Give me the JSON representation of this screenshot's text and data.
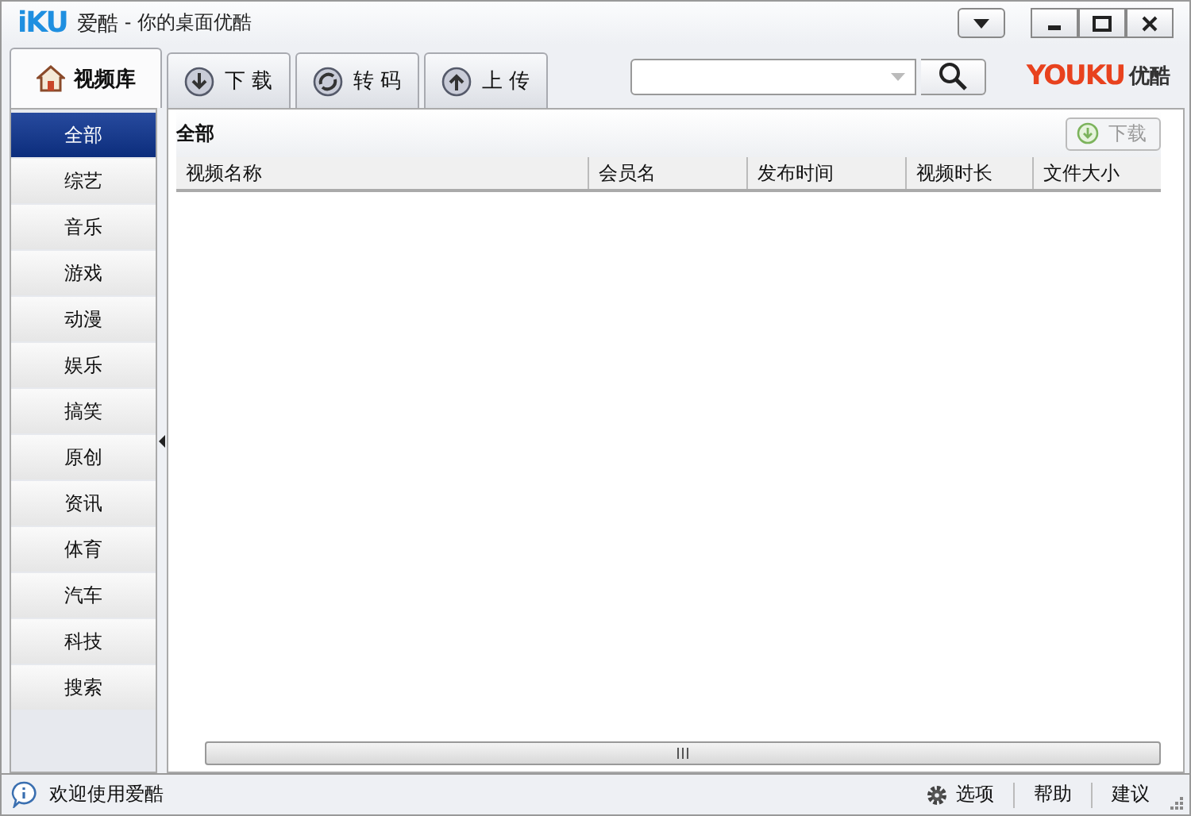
{
  "window": {
    "logo": "iKU",
    "app_name": "爱酷",
    "subtitle": "- 你的桌面优酷"
  },
  "tabs": [
    {
      "label": "视频库",
      "kind": "home",
      "selected": true
    },
    {
      "label": "下 载",
      "kind": "download",
      "selected": false
    },
    {
      "label": "转 码",
      "kind": "convert",
      "selected": false
    },
    {
      "label": "上 传",
      "kind": "upload",
      "selected": false
    }
  ],
  "brand": {
    "logo": "YOUKU",
    "name": "优酷"
  },
  "sidebar": {
    "items": [
      {
        "label": "全部",
        "selected": true
      },
      {
        "label": "综艺",
        "selected": false
      },
      {
        "label": "音乐",
        "selected": false
      },
      {
        "label": "游戏",
        "selected": false
      },
      {
        "label": "动漫",
        "selected": false
      },
      {
        "label": "娱乐",
        "selected": false
      },
      {
        "label": "搞笑",
        "selected": false
      },
      {
        "label": "原创",
        "selected": false
      },
      {
        "label": "资讯",
        "selected": false
      },
      {
        "label": "体育",
        "selected": false
      },
      {
        "label": "汽车",
        "selected": false
      },
      {
        "label": "科技",
        "selected": false
      },
      {
        "label": "搜索",
        "selected": false
      }
    ]
  },
  "panel": {
    "title": "全部",
    "download_button": {
      "label": "下载",
      "disabled": true
    }
  },
  "table": {
    "columns": [
      "视频名称",
      "会员名",
      "发布时间",
      "视频时长",
      "文件大小"
    ]
  },
  "status_bar": {
    "message": "欢迎使用爱酷",
    "links": [
      "选项",
      "帮助",
      "建议"
    ]
  }
}
